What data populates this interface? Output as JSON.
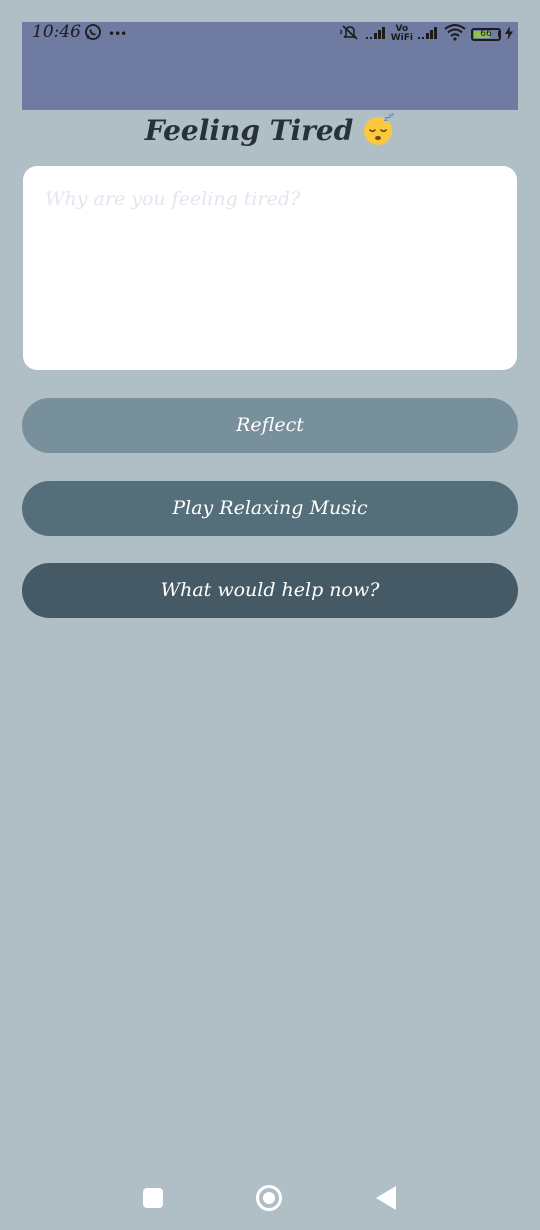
{
  "status_bar": {
    "time": "10:46",
    "more_indicator": "•••",
    "vowifi_top": "Vo",
    "vowifi_bottom": "WiFi",
    "battery_level": "66",
    "battery_percent": 66,
    "background_color": "#6f7ba0",
    "icons": [
      "whatsapp-icon",
      "more-icon",
      "mute-icon",
      "signal-icon",
      "vowifi-icon",
      "signal-icon",
      "wifi-icon",
      "battery-icon",
      "charging-icon"
    ]
  },
  "header": {
    "title": "Feeling Tired",
    "emoji_icon": "sleeping-face-icon"
  },
  "input": {
    "placeholder": "Why are you feeling tired?",
    "value": ""
  },
  "buttons": {
    "reflect_label": "Reflect",
    "music_label": "Play Relaxing Music",
    "help_label": "What would help now?"
  },
  "nav": {
    "icons": [
      "recents-icon",
      "home-icon",
      "back-icon"
    ]
  },
  "colors": {
    "background": "#b0bec5",
    "title": "#263238",
    "reflect_button": "#78909c",
    "music_button": "#546e7a",
    "help_button": "#455a64"
  }
}
